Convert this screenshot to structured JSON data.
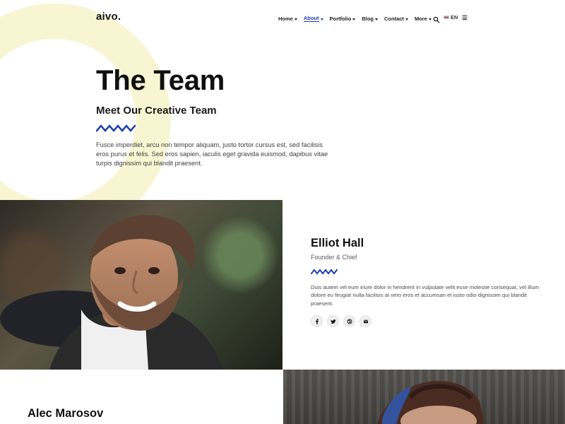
{
  "header": {
    "logo": "aivo.",
    "nav": [
      {
        "label": "Home",
        "active": false
      },
      {
        "label": "About",
        "active": true
      },
      {
        "label": "Portfolio",
        "active": false
      },
      {
        "label": "Blog",
        "active": false
      },
      {
        "label": "Contact",
        "active": false
      },
      {
        "label": "More",
        "active": false
      }
    ],
    "language": "EN",
    "icons": {
      "search": "search-icon",
      "flag": "uk-flag-icon",
      "menu": "menu-icon"
    }
  },
  "hero": {
    "title": "The Team",
    "subtitle": "Meet Our Creative Team",
    "text": "Fusce imperdiet, arcu non tempor aliquam, justo tortor cursus est, sed facilisis eros purus et felis. Sed eros sapien, iaculis eget gravida euismod, dapibus vitae turpis dignissim qui blandit praesent."
  },
  "members": [
    {
      "name": "Elliot Hall",
      "role": "Founder & Chief",
      "bio": "Duis autem vel eum iriure dolor in hendrerit in vulputate velit esse molestie consequat, vel illum dolore eu feugiat nulla facilisis at vero eros et accumsan et iusto odio dignissim qui blandit praesent.",
      "socials": [
        "facebook-icon",
        "twitter-icon",
        "dribbble-icon",
        "email-icon"
      ]
    },
    {
      "name": "Alec Marosov",
      "role": "",
      "bio": "",
      "socials": []
    }
  ],
  "colors": {
    "accent": "#1f3db0",
    "ring": "#f8f6d2",
    "text_dark": "#111111",
    "text_muted": "#5c5c5c"
  }
}
